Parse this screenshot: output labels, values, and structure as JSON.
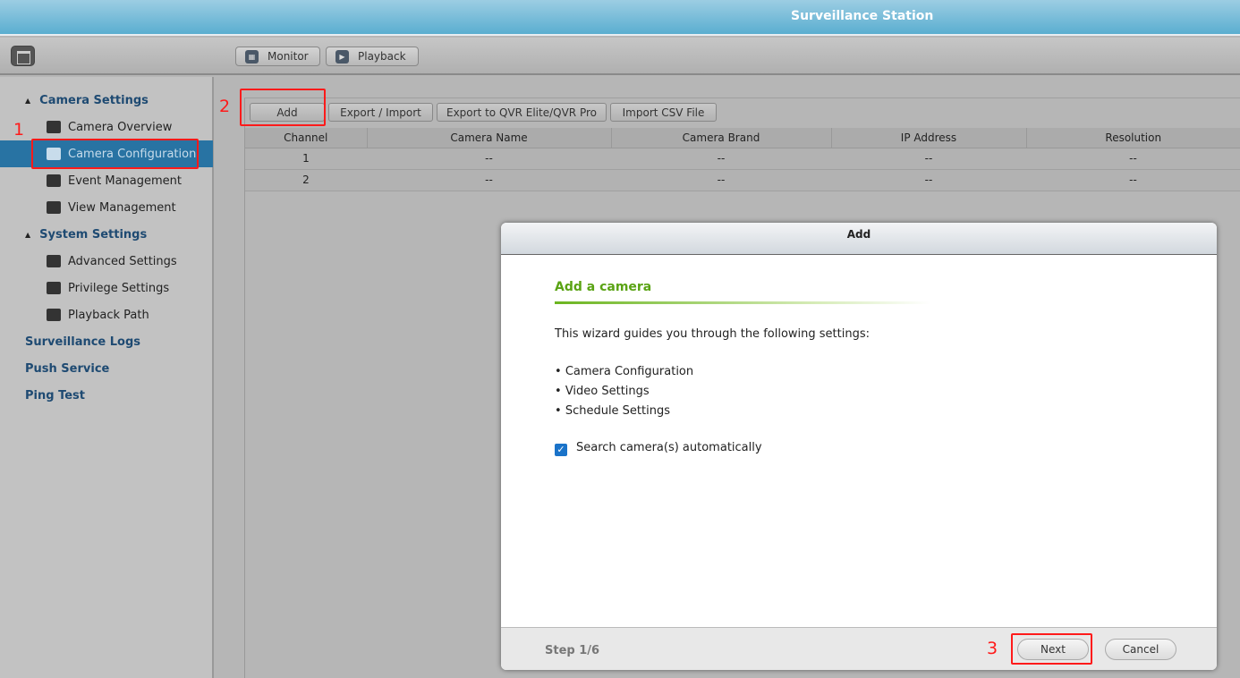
{
  "app": {
    "title": "Surveillance Station"
  },
  "toolbar": {
    "monitor": "Monitor",
    "playback": "Playback"
  },
  "sidebar": {
    "items": [
      {
        "label": "Camera Settings",
        "type": "group",
        "expanded": true
      },
      {
        "label": "Camera Overview",
        "icon": "list-icon"
      },
      {
        "label": "Camera Configuration",
        "icon": "camera-icon",
        "active": true
      },
      {
        "label": "Event Management",
        "icon": "alert-icon"
      },
      {
        "label": "View Management",
        "icon": "grid-icon"
      },
      {
        "label": "System Settings",
        "type": "group",
        "expanded": true
      },
      {
        "label": "Advanced Settings",
        "icon": "wrench-icon"
      },
      {
        "label": "Privilege Settings",
        "icon": "user-icon"
      },
      {
        "label": "Playback Path",
        "icon": "playback-path-icon"
      },
      {
        "label": "Surveillance Logs",
        "type": "group"
      },
      {
        "label": "Push Service",
        "type": "group"
      },
      {
        "label": "Ping Test",
        "type": "group"
      }
    ]
  },
  "actions": {
    "add": "Add",
    "export_import": "Export / Import",
    "export_qvr": "Export to QVR Elite/QVR Pro",
    "import_csv": "Import CSV File"
  },
  "table": {
    "columns": [
      "Channel",
      "Camera Name",
      "Camera Brand",
      "IP Address",
      "Resolution"
    ],
    "rows": [
      [
        "1",
        "--",
        "--",
        "--",
        "--"
      ],
      [
        "2",
        "--",
        "--",
        "--",
        "--"
      ]
    ]
  },
  "annotations": [
    "1",
    "2",
    "3"
  ],
  "dialog": {
    "title": "Add",
    "heading": "Add a camera",
    "intro": "This wizard guides you through the following settings:",
    "bullets": [
      "Camera Configuration",
      "Video Settings",
      "Schedule Settings"
    ],
    "checkbox_label": "Search camera(s) automatically",
    "checkbox_checked": true,
    "step": "Step 1/6",
    "next": "Next",
    "cancel": "Cancel"
  },
  "colors": {
    "accent": "#2873a3",
    "heading_green": "#5aa314",
    "annotation_red": "#ff1a1a"
  }
}
